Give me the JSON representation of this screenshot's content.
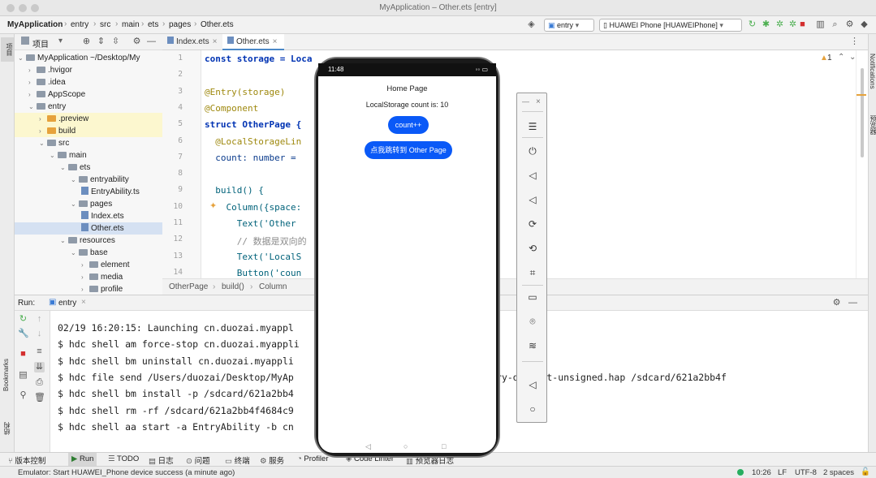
{
  "window": {
    "title": "MyApplication – Other.ets [entry]"
  },
  "nav": {
    "crumbs": [
      "MyApplication",
      "entry",
      "src",
      "main",
      "ets",
      "pages",
      "Other.ets"
    ],
    "run_config": "entry",
    "device": "HUAWEI Phone [HUAWEIPhone]"
  },
  "project_panel": {
    "title": "项目",
    "tree": [
      {
        "label": "MyApplication ~/Desktop/My",
        "depth": 0,
        "kind": "folder",
        "open": true
      },
      {
        "label": ".hvigor",
        "depth": 1,
        "kind": "folder"
      },
      {
        "label": ".idea",
        "depth": 1,
        "kind": "folder"
      },
      {
        "label": "AppScope",
        "depth": 1,
        "kind": "folder"
      },
      {
        "label": "entry",
        "depth": 1,
        "kind": "folder",
        "open": true
      },
      {
        "label": ".preview",
        "depth": 2,
        "kind": "folder-orange",
        "highlight": true
      },
      {
        "label": "build",
        "depth": 2,
        "kind": "folder-orange",
        "highlight": true
      },
      {
        "label": "src",
        "depth": 2,
        "kind": "folder",
        "open": true
      },
      {
        "label": "main",
        "depth": 3,
        "kind": "folder",
        "open": true
      },
      {
        "label": "ets",
        "depth": 4,
        "kind": "folder",
        "open": true
      },
      {
        "label": "entryability",
        "depth": 5,
        "kind": "folder",
        "open": true
      },
      {
        "label": "EntryAbility.ts",
        "depth": 6,
        "kind": "file"
      },
      {
        "label": "pages",
        "depth": 5,
        "kind": "folder",
        "open": true
      },
      {
        "label": "Index.ets",
        "depth": 6,
        "kind": "file"
      },
      {
        "label": "Other.ets",
        "depth": 6,
        "kind": "file",
        "selected": true
      },
      {
        "label": "resources",
        "depth": 4,
        "kind": "folder",
        "open": true
      },
      {
        "label": "base",
        "depth": 5,
        "kind": "folder",
        "open": true
      },
      {
        "label": "element",
        "depth": 6,
        "kind": "folder"
      },
      {
        "label": "media",
        "depth": 6,
        "kind": "folder"
      },
      {
        "label": "profile",
        "depth": 6,
        "kind": "folder"
      }
    ]
  },
  "editor": {
    "tabs": [
      {
        "label": "Index.ets"
      },
      {
        "label": "Other.ets",
        "active": true
      }
    ],
    "warning_count": "1",
    "lines": [
      {
        "n": "1",
        "text": "const storage = Loca"
      },
      {
        "n": "2",
        "text": ""
      },
      {
        "n": "3",
        "text": "@Entry(storage)"
      },
      {
        "n": "4",
        "text": "@Component"
      },
      {
        "n": "5",
        "text": "struct OtherPage {"
      },
      {
        "n": "6",
        "text": "  @LocalStorageLin"
      },
      {
        "n": "7",
        "text": "  count: number ="
      },
      {
        "n": "8",
        "text": ""
      },
      {
        "n": "9",
        "text": "  build() {"
      },
      {
        "n": "10",
        "text": "    Column({space:"
      },
      {
        "n": "11",
        "text": "      Text('Other"
      },
      {
        "n": "12",
        "text": "      // 数据是双向的"
      },
      {
        "n": "13",
        "text": "      Text('LocalS"
      },
      {
        "n": "14",
        "text": "      Button('coun"
      }
    ],
    "breadcrumb": [
      "OtherPage",
      "build()",
      "Column"
    ]
  },
  "run_panel": {
    "label": "Run:",
    "tab": "entry",
    "console_lines": [
      "02/19 16:20:15: Launching cn.duozai.myappl",
      "$ hdc shell am force-stop cn.duozai.myappli",
      "$ hdc shell bm uninstall cn.duozai.myappli",
      "$ hdc file send /Users/duozai/Desktop/MyAp                    ntry default/entry-default-unsigned.hap /sdcard/621a2bb4f",
      "$ hdc shell bm install -p /sdcard/621a2bb4",
      "$ hdc shell rm -rf /sdcard/621a2bb4f4684c9",
      "$ hdc shell aa start -a EntryAbility -b cn"
    ]
  },
  "bottom_tools": [
    {
      "label": "版本控制"
    },
    {
      "label": "Run",
      "active": true
    },
    {
      "label": "TODO"
    },
    {
      "label": "日志"
    },
    {
      "label": "问题"
    },
    {
      "label": "终端"
    },
    {
      "label": "服务"
    },
    {
      "label": "Profiler"
    },
    {
      "label": "Code Linter"
    },
    {
      "label": "预览器日志"
    }
  ],
  "statusbar": {
    "message": "Emulator: Start HUAWEI_Phone device success (a minute ago)",
    "position": "10:26",
    "line_sep": "LF",
    "encoding": "UTF-8",
    "indent": "2 spaces"
  },
  "left_strip": {
    "project": "项目",
    "bookmarks": "Bookmarks",
    "structure": "结构"
  },
  "right_strip": {
    "notifications": "Notifications",
    "previewer": "预览器"
  },
  "phone": {
    "time": "11:48",
    "battery": "◦◦ ▭",
    "heading": "Home Page",
    "count_text": "LocalStorage count is: 10",
    "count_button": "count++",
    "nav_button": "点我跳转到 Other Page"
  },
  "emulator_panel": {
    "icons": [
      "menu-icon",
      "power-icon",
      "volume-down-icon",
      "volume-up-icon",
      "rotate-icon",
      "rotate-back-icon",
      "screenshot-icon",
      "battery-icon",
      "location-icon",
      "network-icon",
      "back-icon",
      "home-icon"
    ]
  },
  "colors": {
    "accent": "#0a59f7",
    "selection": "#d5e1f2",
    "highlight": "#fcf7cf"
  }
}
